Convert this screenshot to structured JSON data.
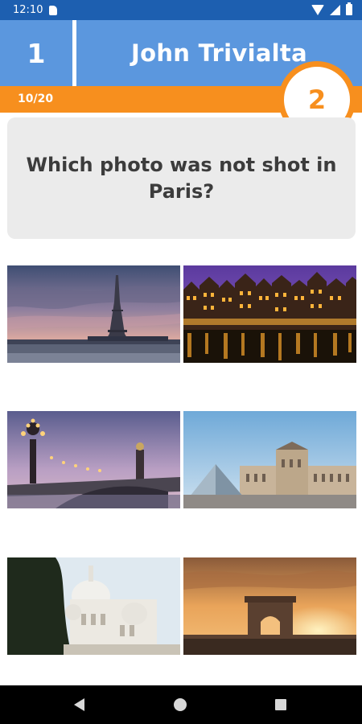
{
  "status_bar": {
    "time": "12:10",
    "icons": [
      "sd-card-icon",
      "wifi-icon",
      "cell-signal-icon",
      "battery-icon"
    ]
  },
  "header": {
    "round_number": "1",
    "player_name": "John Trivialta"
  },
  "progress": {
    "label": "10/20",
    "fraction": 0.5
  },
  "score": "2",
  "question": {
    "text": "Which photo was not shot in Paris?"
  },
  "options": [
    {
      "subject": "Eiffel Tower"
    },
    {
      "subject": "Amsterdam canal houses at night"
    },
    {
      "subject": "Pont Alexandre III"
    },
    {
      "subject": "Louvre pyramid"
    },
    {
      "subject": "Sacré-Cœur Basilica"
    },
    {
      "subject": "Arc de Triomphe at sunset"
    }
  ],
  "colors": {
    "status_bar": "#1d5fb0",
    "header": "#5b97de",
    "accent": "#f78f1e",
    "card": "#ebebeb",
    "question_text": "#3c3c3c"
  },
  "navigation": {
    "icons": [
      "back-icon",
      "home-icon",
      "recents-icon"
    ]
  }
}
